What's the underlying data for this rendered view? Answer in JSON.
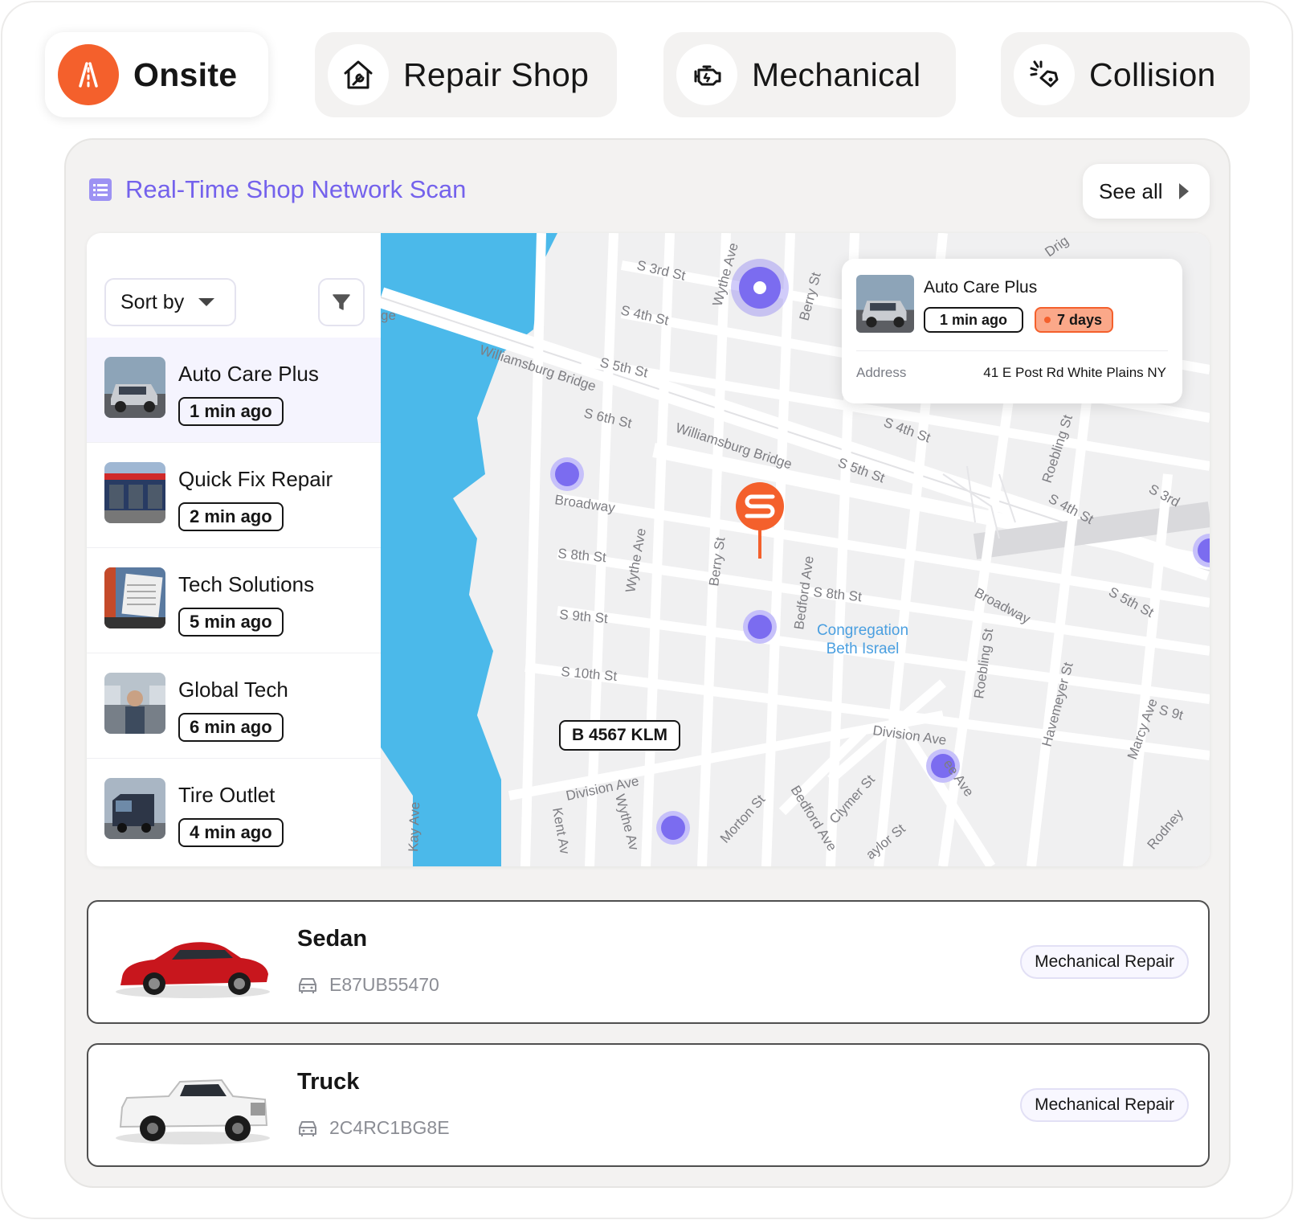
{
  "tabs": [
    {
      "label": "Onsite",
      "icon": "road-icon",
      "active": true
    },
    {
      "label": "Repair Shop",
      "icon": "house-wrench-icon",
      "active": false
    },
    {
      "label": "Mechanical",
      "icon": "engine-icon",
      "active": false
    },
    {
      "label": "Collision",
      "icon": "car-crash-icon",
      "active": false
    }
  ],
  "scan": {
    "title": "Real-Time Shop Network Scan",
    "see_all": "See all",
    "sort_by": "Sort by"
  },
  "shops": [
    {
      "name": "Auto Care Plus",
      "time": "1 min ago"
    },
    {
      "name": "Quick Fix Repair",
      "time": "2 min ago"
    },
    {
      "name": "Tech Solutions",
      "time": "5 min ago"
    },
    {
      "name": "Global Tech",
      "time": "6 min ago"
    },
    {
      "name": "Tire Outlet",
      "time": "4 min ago"
    }
  ],
  "popup": {
    "name": "Auto Care Plus",
    "time": "1 min ago",
    "days": "7 days",
    "address_label": "Address",
    "address": "41 E Post Rd White Plains NY"
  },
  "map": {
    "plate": "B 4567 KLM",
    "streets": {
      "s3rd": "S 3rd St",
      "s4th": "S 4th St",
      "s5th": "S 5th St",
      "s6th": "S 6th St",
      "s8th": "S 8th St",
      "s9th": "S 9th St",
      "s10th": "S 10th St",
      "s4th_b": "S 4th St",
      "s5th_b": "S 5th St",
      "s4th_c": "S 4th St",
      "s5th_c": "S 5th St",
      "s3rd_c": "S 3rd",
      "s8th_b": "S 8th St",
      "s9_c": "S 9t",
      "wburg1": "Williamsburg Bridge",
      "wburg2": "Williamsburg Bridge",
      "broadway": "Broadway",
      "broadway2": "Broadway",
      "division": "Division Ave",
      "division2": "Division Ave",
      "wythe": "Wythe Ave",
      "wythe2": "Wythe Ave",
      "wythe3": "Wythe Av",
      "berry": "Berry St",
      "berry2": "Berry St",
      "bedford": "Bedford Ave",
      "bedford2": "Bedford Ave",
      "roebling": "Roebling St",
      "roebling2": "Roebling St",
      "havemeyer": "Havemeyer St",
      "marcy": "Marcy Ave",
      "kay": "Kay Ave",
      "kent": "Kent Av",
      "morton": "Morton St",
      "clymer": "Clymer St",
      "taylor": "aylor St",
      "lee": "ee Ave",
      "driggs": "Drig",
      "rodney": "Rodney",
      "ge": "ge",
      "congregation1": "Congregation",
      "congregation2": "Beth Israel"
    }
  },
  "vehicles": [
    {
      "type": "Sedan",
      "vin": "E87UB55470",
      "tag": "Mechanical Repair",
      "color": "#c8161d"
    },
    {
      "type": "Truck",
      "vin": "2C4RC1BG8E",
      "tag": "Mechanical Repair",
      "color": "#f3f3f3"
    }
  ],
  "colors": {
    "accent": "#7462ec",
    "brand_orange": "#f4602c",
    "water": "#4bb9ea",
    "map_bg": "#f0f0f1",
    "pin": "#7b6cf0"
  }
}
